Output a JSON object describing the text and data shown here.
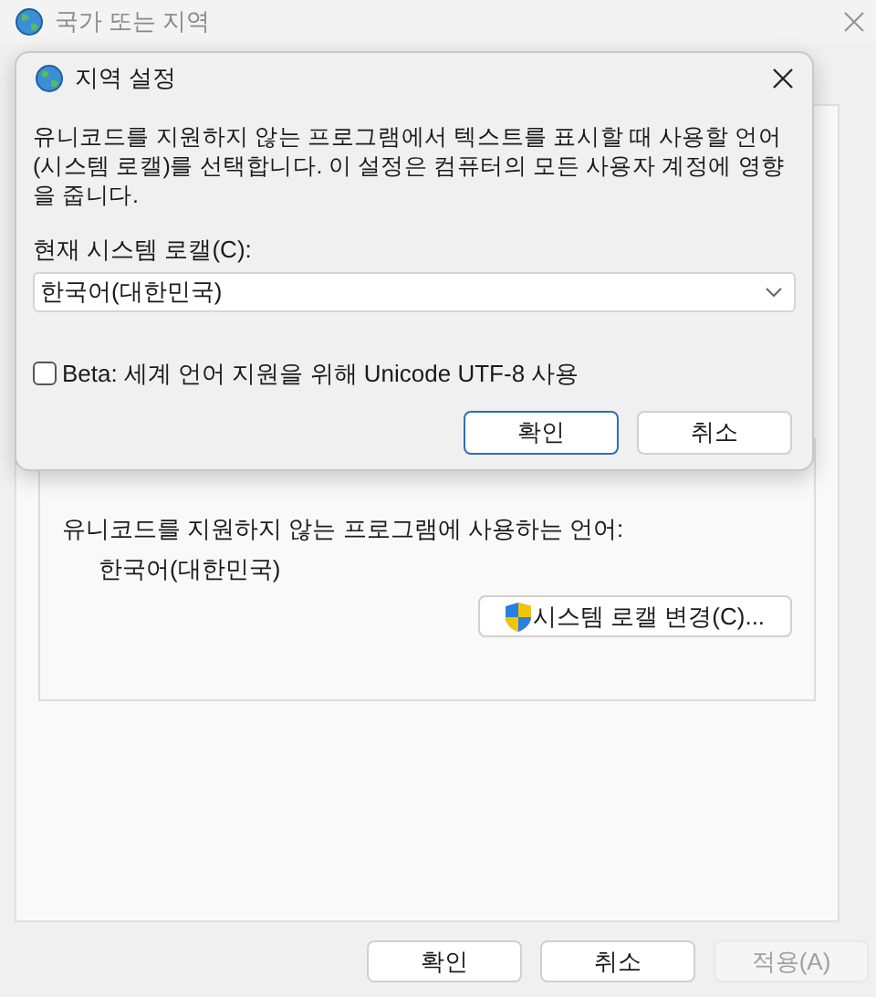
{
  "window": {
    "title": "국가 또는 지역"
  },
  "group": {
    "label": "유니코드를 지원하지 않는 프로그램에 사용하는 언어:",
    "value": "한국어(대한민국)",
    "change_button": "시스템 로캘 변경(C)..."
  },
  "buttons": [
    {
      "label": "확인",
      "disabled": false
    },
    {
      "label": "취소",
      "disabled": false
    },
    {
      "label": "적용(A)",
      "disabled": true
    }
  ],
  "dialog": {
    "title": "지역 설정",
    "description": "유니코드를 지원하지 않는 프로그램에서 텍스트를 표시할 때 사용할 언어(시스템 로캘)를 선택합니다. 이 설정은 컴퓨터의 모든 사용자 계정에 영향을 줍니다.",
    "locale_label": "현재 시스템 로캘(C):",
    "locale_value": "한국어(대한민국)",
    "utf8_option": {
      "label": "Beta: 세계 언어 지원을 위해 Unicode UTF-8 사용",
      "checked": false
    },
    "buttons": [
      {
        "label": "확인",
        "focused": true
      },
      {
        "label": "취소",
        "focused": false
      }
    ]
  }
}
